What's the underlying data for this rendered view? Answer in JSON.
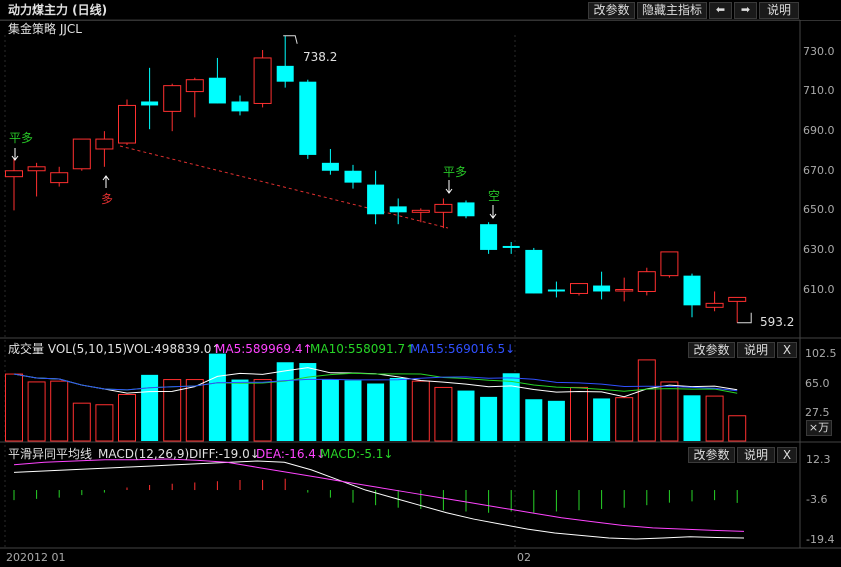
{
  "header": {
    "title": "动力煤主力 (日线)",
    "buttons": [
      "改参数",
      "隐藏主指标",
      "⬅",
      "➡",
      "说明"
    ]
  },
  "main_panel": {
    "strategy_label": "集金策略 JJCL",
    "y_ticks": [
      "730.0",
      "710.0",
      "690.0",
      "670.0",
      "650.0",
      "630.0",
      "610.0"
    ],
    "high_label": "738.2",
    "low_label": "593.2",
    "signals": [
      {
        "text": "平多",
        "color": "#27c527"
      },
      {
        "text": "多",
        "color": "#e03030"
      },
      {
        "text": "平多",
        "color": "#27c527"
      },
      {
        "text": "空",
        "color": "#27c527"
      }
    ]
  },
  "volume_panel": {
    "label": "成交量 VOL(5,10,15)",
    "vol": "VOL:498839.0↑",
    "ma5": "MA5:589969.4↑",
    "ma10": "MA10:558091.7↑",
    "ma15": "MA15:569016.5↓",
    "buttons": [
      "改参数",
      "说明",
      "X"
    ],
    "y_ticks": [
      "102.5",
      "65.0",
      "27.5"
    ],
    "unit": "×万"
  },
  "macd_panel": {
    "label": "平滑异同平均线",
    "macd": "MACD(12,26,9)",
    "diff": "DIFF:-19.0↓",
    "dea": "DEA:-16.4↓",
    "macd_val": "MACD:-5.1↓",
    "buttons": [
      "改参数",
      "说明",
      "X"
    ],
    "y_ticks": [
      "12.3",
      "-3.6",
      "-19.4"
    ]
  },
  "x_axis": {
    "start_label": "202012 01",
    "mid_label": "02"
  },
  "colors": {
    "up": "#ff3030",
    "down": "#00ffff",
    "ma5": "#ffffff",
    "ma10": "#e8e800",
    "ma15": "#ff00ff",
    "dea": "#ff44ff",
    "macd_green": "#27d427"
  },
  "chart_data": {
    "type": "candlestick",
    "candles": [
      {
        "o": 667,
        "h": 676,
        "l": 650,
        "c": 670
      },
      {
        "o": 670,
        "h": 674,
        "l": 657,
        "c": 672
      },
      {
        "o": 664,
        "h": 672,
        "l": 662,
        "c": 669
      },
      {
        "o": 671,
        "h": 686,
        "l": 670,
        "c": 686
      },
      {
        "o": 681,
        "h": 690,
        "l": 672,
        "c": 686
      },
      {
        "o": 684,
        "h": 706,
        "l": 683,
        "c": 703
      },
      {
        "o": 705,
        "h": 722,
        "l": 691,
        "c": 703
      },
      {
        "o": 700,
        "h": 714,
        "l": 690,
        "c": 713
      },
      {
        "o": 710,
        "h": 717,
        "l": 697,
        "c": 716
      },
      {
        "o": 717,
        "h": 727,
        "l": 704,
        "c": 704
      },
      {
        "o": 705,
        "h": 708,
        "l": 698,
        "c": 700
      },
      {
        "o": 704,
        "h": 731,
        "l": 702,
        "c": 727
      },
      {
        "o": 723,
        "h": 738.2,
        "l": 712,
        "c": 715
      },
      {
        "o": 715,
        "h": 716,
        "l": 676,
        "c": 678
      },
      {
        "o": 674,
        "h": 681,
        "l": 668,
        "c": 670
      },
      {
        "o": 670,
        "h": 673,
        "l": 661,
        "c": 664
      },
      {
        "o": 663,
        "h": 670,
        "l": 643,
        "c": 648
      },
      {
        "o": 652,
        "h": 656,
        "l": 643,
        "c": 649
      },
      {
        "o": 649,
        "h": 651,
        "l": 644,
        "c": 650
      },
      {
        "o": 649,
        "h": 656,
        "l": 641,
        "c": 653
      },
      {
        "o": 654,
        "h": 655,
        "l": 646,
        "c": 647
      },
      {
        "o": 643,
        "h": 644,
        "l": 628,
        "c": 630
      },
      {
        "o": 632,
        "h": 634,
        "l": 628,
        "c": 631
      },
      {
        "o": 630,
        "h": 631,
        "l": 608,
        "c": 608
      },
      {
        "o": 610,
        "h": 614,
        "l": 606,
        "c": 609
      },
      {
        "o": 608,
        "h": 613,
        "l": 607,
        "c": 613
      },
      {
        "o": 612,
        "h": 619,
        "l": 605,
        "c": 609
      },
      {
        "o": 610,
        "h": 616,
        "l": 604,
        "c": 610
      },
      {
        "o": 609,
        "h": 621,
        "l": 607,
        "c": 619
      },
      {
        "o": 617,
        "h": 629,
        "l": 616,
        "c": 629
      },
      {
        "o": 617,
        "h": 618,
        "l": 596,
        "c": 602
      },
      {
        "o": 601,
        "h": 609,
        "l": 599,
        "c": 603
      },
      {
        "o": 604,
        "h": 606,
        "l": 593.2,
        "c": 606
      }
    ],
    "volume": [
      77,
      67,
      68,
      40,
      38,
      51,
      76,
      70,
      70,
      103,
      70,
      70,
      92,
      91,
      70,
      69,
      65,
      72,
      68,
      60,
      56,
      48,
      78,
      45,
      43,
      60,
      46,
      47,
      95,
      67,
      50,
      49,
      24
    ],
    "macd": [
      -4,
      -3.5,
      -3,
      -2,
      -1,
      1,
      2,
      2.5,
      3,
      3.5,
      4,
      4,
      4.5,
      -1,
      -3,
      -5,
      -6,
      -7,
      -7.5,
      -8,
      -8.5,
      -9,
      -8.5,
      -9,
      -8.5,
      -8,
      -7.5,
      -7,
      -6,
      -5,
      -4.5,
      -4,
      -5.1
    ],
    "dea": [
      10,
      11,
      11.5,
      12,
      12,
      12.3,
      11.8,
      11,
      9,
      7,
      5,
      3,
      1,
      -1,
      -3,
      -5,
      -7,
      -9,
      -11,
      -12.5,
      -14,
      -15,
      -15.5,
      -16,
      -16.4
    ],
    "diff": [
      7,
      7.5,
      8,
      8.5,
      9,
      9.5,
      10,
      10.5,
      11,
      11.5,
      11,
      8,
      4,
      0,
      -3,
      -6,
      -9,
      -11.5,
      -13.5,
      -15.5,
      -17,
      -18,
      -19,
      -19.4,
      -19,
      -18.5,
      -18.8,
      -19.0
    ]
  }
}
